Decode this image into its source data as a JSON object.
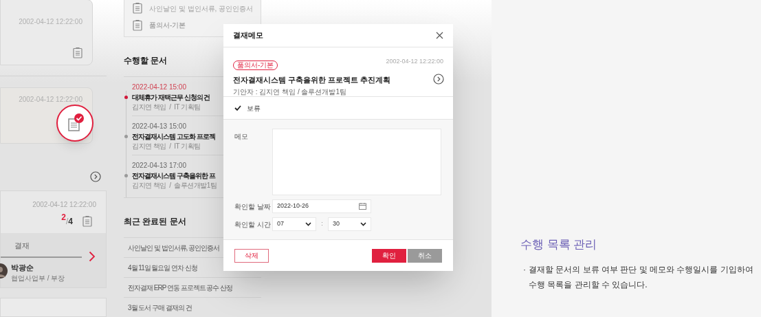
{
  "app": {
    "cards": [
      {
        "date": "2002-04-12 12:22:00",
        "selected": false
      },
      {
        "date": "2002-04-12 12:22:00",
        "selected": true
      }
    ],
    "approval_card": {
      "date": "2002-04-12 12:22:00",
      "current": "2",
      "fraction_bar": "/",
      "total": "4",
      "step_label": "결재",
      "approver_name": "박광순",
      "approver_dept": "협업사업부 / 부장"
    },
    "doc_types": [
      {
        "label": "사인날인 및 법인서류, 공인인증서"
      },
      {
        "label": "품의서-기본"
      }
    ],
    "todo": {
      "title": "수행할 문서",
      "items": [
        {
          "time": "2022-04-12 15:00",
          "title": "대체휴가 재택근무 신청의 건",
          "meta": "김지연 책임  /  IT 기획팀",
          "urgent": true
        },
        {
          "time": "2022-04-13 15:00",
          "title": "전자결재시스템 고도화 프로젝",
          "meta": "김지연 책임  /  IT 기획팀",
          "urgent": false
        },
        {
          "time": "2022-04-13 17:00",
          "title": "전자결재시스템 구축을위한 프",
          "meta": "김지연 책임  /  솔루션개발1팀",
          "urgent": false
        }
      ]
    },
    "recent": {
      "title": "최근 완료된 문서",
      "items": [
        "사인날인 및 법인서류, 공인인증서",
        "4월 11일 월요일 연차 신청",
        "전자결재 ERP 연동 프로젝트 공수 산정",
        "3월 도서 구매 결재의 건"
      ]
    }
  },
  "modal": {
    "title": "결재메모",
    "doc": {
      "tag": "품의서-기본",
      "date": "2002-04-12 12:22:00",
      "title": "전자결재시스템 구축을위한 프로젝트 추진계획",
      "drafter": "기안자 : 김지연 책임 / 솔루션개발1팀"
    },
    "hold": {
      "label": "보류",
      "checked": true
    },
    "memo_label": "메모",
    "date_label": "확인할 날짜",
    "date_value": "2022-10-26",
    "time_label": "확인할 시간",
    "hour": "07",
    "separator": ":",
    "minute": "30",
    "buttons": [
      {
        "label": "삭제",
        "kind": "outline"
      },
      {
        "label": "확인",
        "kind": "primary"
      },
      {
        "label": "취소",
        "kind": "secondary"
      }
    ]
  },
  "feature": {
    "title": "수행 목록 관리",
    "bullet": "·",
    "description": "결재할 문서의 보류 여부 판단 및 메모와 수행일시를 기입하여 수행 목록을 관리할 수 있습니다."
  }
}
